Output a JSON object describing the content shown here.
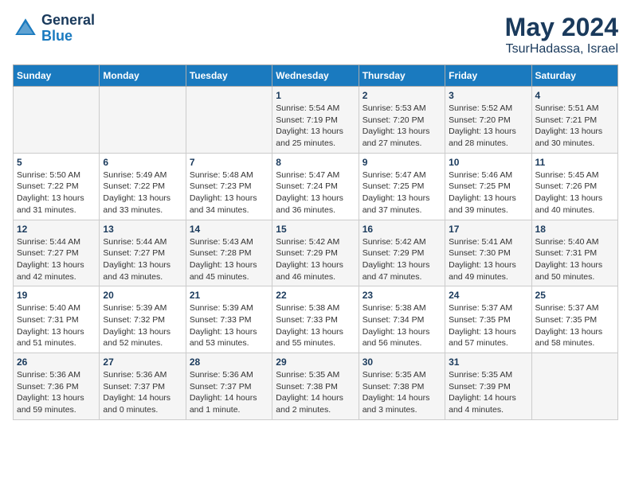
{
  "header": {
    "logo_line1": "General",
    "logo_line2": "Blue",
    "month_year": "May 2024",
    "location": "TsurHadassa, Israel"
  },
  "weekdays": [
    "Sunday",
    "Monday",
    "Tuesday",
    "Wednesday",
    "Thursday",
    "Friday",
    "Saturday"
  ],
  "weeks": [
    [
      {
        "day": "",
        "detail": ""
      },
      {
        "day": "",
        "detail": ""
      },
      {
        "day": "",
        "detail": ""
      },
      {
        "day": "1",
        "detail": "Sunrise: 5:54 AM\nSunset: 7:19 PM\nDaylight: 13 hours\nand 25 minutes."
      },
      {
        "day": "2",
        "detail": "Sunrise: 5:53 AM\nSunset: 7:20 PM\nDaylight: 13 hours\nand 27 minutes."
      },
      {
        "day": "3",
        "detail": "Sunrise: 5:52 AM\nSunset: 7:20 PM\nDaylight: 13 hours\nand 28 minutes."
      },
      {
        "day": "4",
        "detail": "Sunrise: 5:51 AM\nSunset: 7:21 PM\nDaylight: 13 hours\nand 30 minutes."
      }
    ],
    [
      {
        "day": "5",
        "detail": "Sunrise: 5:50 AM\nSunset: 7:22 PM\nDaylight: 13 hours\nand 31 minutes."
      },
      {
        "day": "6",
        "detail": "Sunrise: 5:49 AM\nSunset: 7:22 PM\nDaylight: 13 hours\nand 33 minutes."
      },
      {
        "day": "7",
        "detail": "Sunrise: 5:48 AM\nSunset: 7:23 PM\nDaylight: 13 hours\nand 34 minutes."
      },
      {
        "day": "8",
        "detail": "Sunrise: 5:47 AM\nSunset: 7:24 PM\nDaylight: 13 hours\nand 36 minutes."
      },
      {
        "day": "9",
        "detail": "Sunrise: 5:47 AM\nSunset: 7:25 PM\nDaylight: 13 hours\nand 37 minutes."
      },
      {
        "day": "10",
        "detail": "Sunrise: 5:46 AM\nSunset: 7:25 PM\nDaylight: 13 hours\nand 39 minutes."
      },
      {
        "day": "11",
        "detail": "Sunrise: 5:45 AM\nSunset: 7:26 PM\nDaylight: 13 hours\nand 40 minutes."
      }
    ],
    [
      {
        "day": "12",
        "detail": "Sunrise: 5:44 AM\nSunset: 7:27 PM\nDaylight: 13 hours\nand 42 minutes."
      },
      {
        "day": "13",
        "detail": "Sunrise: 5:44 AM\nSunset: 7:27 PM\nDaylight: 13 hours\nand 43 minutes."
      },
      {
        "day": "14",
        "detail": "Sunrise: 5:43 AM\nSunset: 7:28 PM\nDaylight: 13 hours\nand 45 minutes."
      },
      {
        "day": "15",
        "detail": "Sunrise: 5:42 AM\nSunset: 7:29 PM\nDaylight: 13 hours\nand 46 minutes."
      },
      {
        "day": "16",
        "detail": "Sunrise: 5:42 AM\nSunset: 7:29 PM\nDaylight: 13 hours\nand 47 minutes."
      },
      {
        "day": "17",
        "detail": "Sunrise: 5:41 AM\nSunset: 7:30 PM\nDaylight: 13 hours\nand 49 minutes."
      },
      {
        "day": "18",
        "detail": "Sunrise: 5:40 AM\nSunset: 7:31 PM\nDaylight: 13 hours\nand 50 minutes."
      }
    ],
    [
      {
        "day": "19",
        "detail": "Sunrise: 5:40 AM\nSunset: 7:31 PM\nDaylight: 13 hours\nand 51 minutes."
      },
      {
        "day": "20",
        "detail": "Sunrise: 5:39 AM\nSunset: 7:32 PM\nDaylight: 13 hours\nand 52 minutes."
      },
      {
        "day": "21",
        "detail": "Sunrise: 5:39 AM\nSunset: 7:33 PM\nDaylight: 13 hours\nand 53 minutes."
      },
      {
        "day": "22",
        "detail": "Sunrise: 5:38 AM\nSunset: 7:33 PM\nDaylight: 13 hours\nand 55 minutes."
      },
      {
        "day": "23",
        "detail": "Sunrise: 5:38 AM\nSunset: 7:34 PM\nDaylight: 13 hours\nand 56 minutes."
      },
      {
        "day": "24",
        "detail": "Sunrise: 5:37 AM\nSunset: 7:35 PM\nDaylight: 13 hours\nand 57 minutes."
      },
      {
        "day": "25",
        "detail": "Sunrise: 5:37 AM\nSunset: 7:35 PM\nDaylight: 13 hours\nand 58 minutes."
      }
    ],
    [
      {
        "day": "26",
        "detail": "Sunrise: 5:36 AM\nSunset: 7:36 PM\nDaylight: 13 hours\nand 59 minutes."
      },
      {
        "day": "27",
        "detail": "Sunrise: 5:36 AM\nSunset: 7:37 PM\nDaylight: 14 hours\nand 0 minutes."
      },
      {
        "day": "28",
        "detail": "Sunrise: 5:36 AM\nSunset: 7:37 PM\nDaylight: 14 hours\nand 1 minute."
      },
      {
        "day": "29",
        "detail": "Sunrise: 5:35 AM\nSunset: 7:38 PM\nDaylight: 14 hours\nand 2 minutes."
      },
      {
        "day": "30",
        "detail": "Sunrise: 5:35 AM\nSunset: 7:38 PM\nDaylight: 14 hours\nand 3 minutes."
      },
      {
        "day": "31",
        "detail": "Sunrise: 5:35 AM\nSunset: 7:39 PM\nDaylight: 14 hours\nand 4 minutes."
      },
      {
        "day": "",
        "detail": ""
      }
    ]
  ]
}
